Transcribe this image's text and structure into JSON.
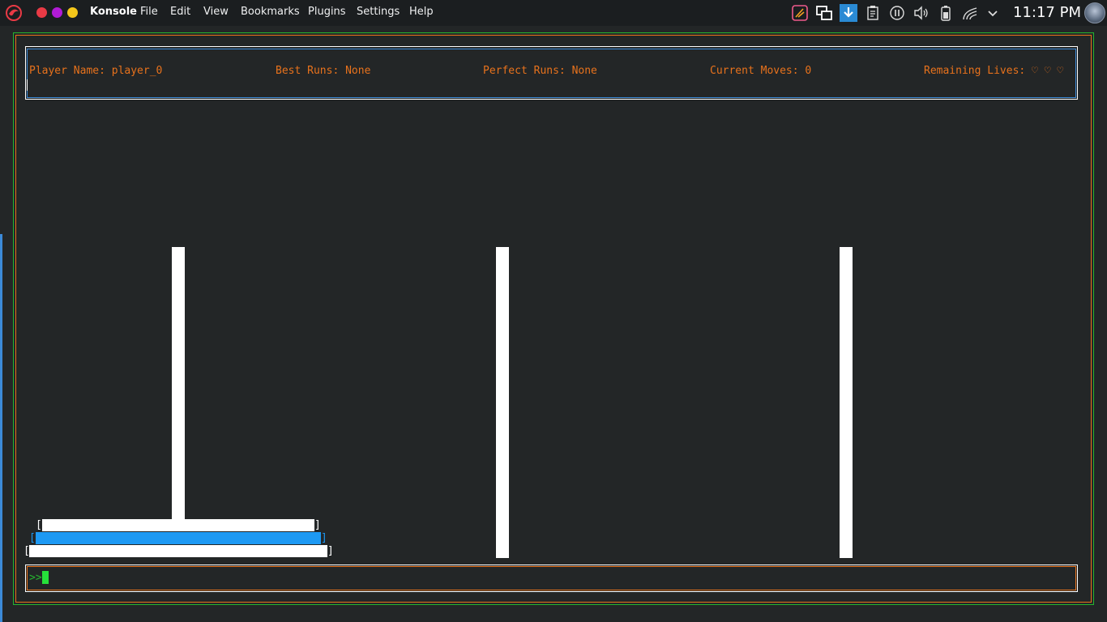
{
  "menubar": {
    "app_name": "Konsole",
    "menus": [
      "File",
      "Edit",
      "View",
      "Bookmarks",
      "Plugins",
      "Settings",
      "Help"
    ],
    "clock": "11:17 PM",
    "tray_icons": [
      "notes-icon",
      "screen-switch-icon",
      "download-icon",
      "clipboard-icon",
      "media-icon",
      "volume-icon",
      "battery-icon",
      "wifi-icon",
      "chevron-down-icon"
    ]
  },
  "stats": {
    "player": "Player Name: player_0",
    "best": "Best Runs: None",
    "perfect": "Perfect Runs: None",
    "moves": "Current Moves: 0",
    "lives": "Remaining Lives: ♡ ♡ ♡"
  },
  "game": {
    "pegs": 3,
    "disks_on_peg_1": [
      "small",
      "medium",
      "large"
    ],
    "disk_colors": [
      "#ffffff",
      "#1d99f3",
      "#ffffff"
    ],
    "bracket_open": "[",
    "bracket_close": "]"
  },
  "prompt": {
    "symbol": ">>",
    "value": ""
  },
  "colors": {
    "accent_orange": "#e8721c",
    "accent_green": "#26b52f",
    "accent_blue": "#3c8ad8",
    "selected_disk": "#1d99f3"
  }
}
